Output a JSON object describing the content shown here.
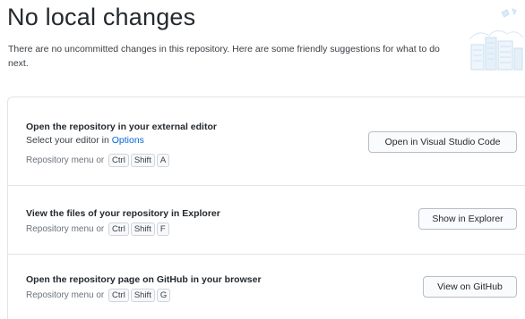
{
  "header": {
    "title": "No local changes",
    "description": "There are no uncommitted changes in this repository. Here are some friendly suggestions for what to do next."
  },
  "illustration": {
    "icon": "city-skyline-illustration"
  },
  "actions": [
    {
      "title": "Open the repository in your external editor",
      "text_prefix": "Select your editor in ",
      "link": "Options",
      "menu": "Repository menu or",
      "keys": [
        "Ctrl",
        "Shift",
        "A"
      ],
      "button": "Open in Visual Studio Code"
    },
    {
      "title": "View the files of your repository in Explorer",
      "menu": "Repository menu or",
      "keys": [
        "Ctrl",
        "Shift",
        "F"
      ],
      "button": "Show in Explorer"
    },
    {
      "title": "Open the repository page on GitHub in your browser",
      "menu": "Repository menu or",
      "keys": [
        "Ctrl",
        "Shift",
        "G"
      ],
      "button": "View on GitHub"
    }
  ]
}
